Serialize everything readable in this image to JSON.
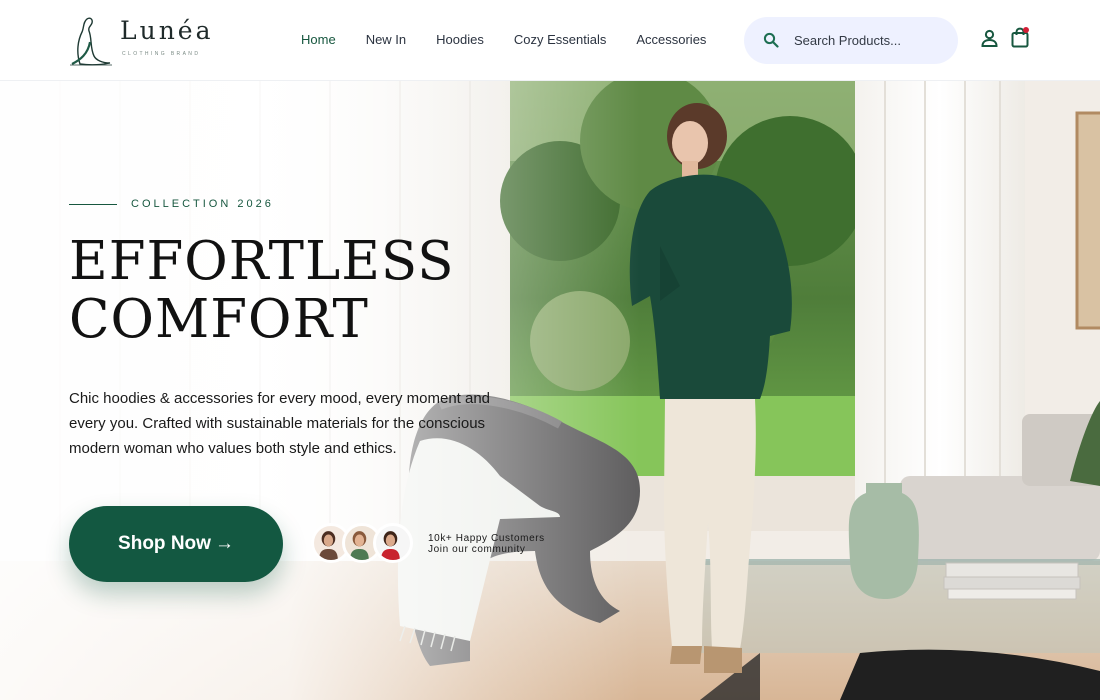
{
  "brand": {
    "name": "Lunéa",
    "tagline": "CLOTHING BRAND"
  },
  "nav": {
    "items": [
      {
        "label": "Home",
        "active": true
      },
      {
        "label": "New In",
        "active": false
      },
      {
        "label": "Hoodies",
        "active": false
      },
      {
        "label": "Cozy Essentials",
        "active": false
      },
      {
        "label": "Accessories",
        "active": false
      }
    ]
  },
  "search": {
    "placeholder": "Search Products...",
    "value": "",
    "icon": "search-icon"
  },
  "header_icons": {
    "user": "user-icon",
    "cart": "shopping-bag-icon",
    "cart_badge_color": "#d21f36"
  },
  "hero": {
    "eyebrow": "COLLECTION 2026",
    "headline_line1": "EFFORTLESS",
    "headline_line2": "COMFORT",
    "description": "Chic hoodies & accessories for every mood, every moment and every you. Crafted with sustainable materials for the conscious modern woman who values both style and ethics.",
    "cta_label": "Shop Now",
    "cta_icon": "arrow-right-icon",
    "social_proof_title": "10k+ Happy Customers",
    "social_proof_subtitle": "Join our community"
  },
  "colors": {
    "accent": "#135841",
    "nav_active": "#17573f",
    "search_bg": "#eef1ff",
    "text": "#1a1a1a"
  }
}
